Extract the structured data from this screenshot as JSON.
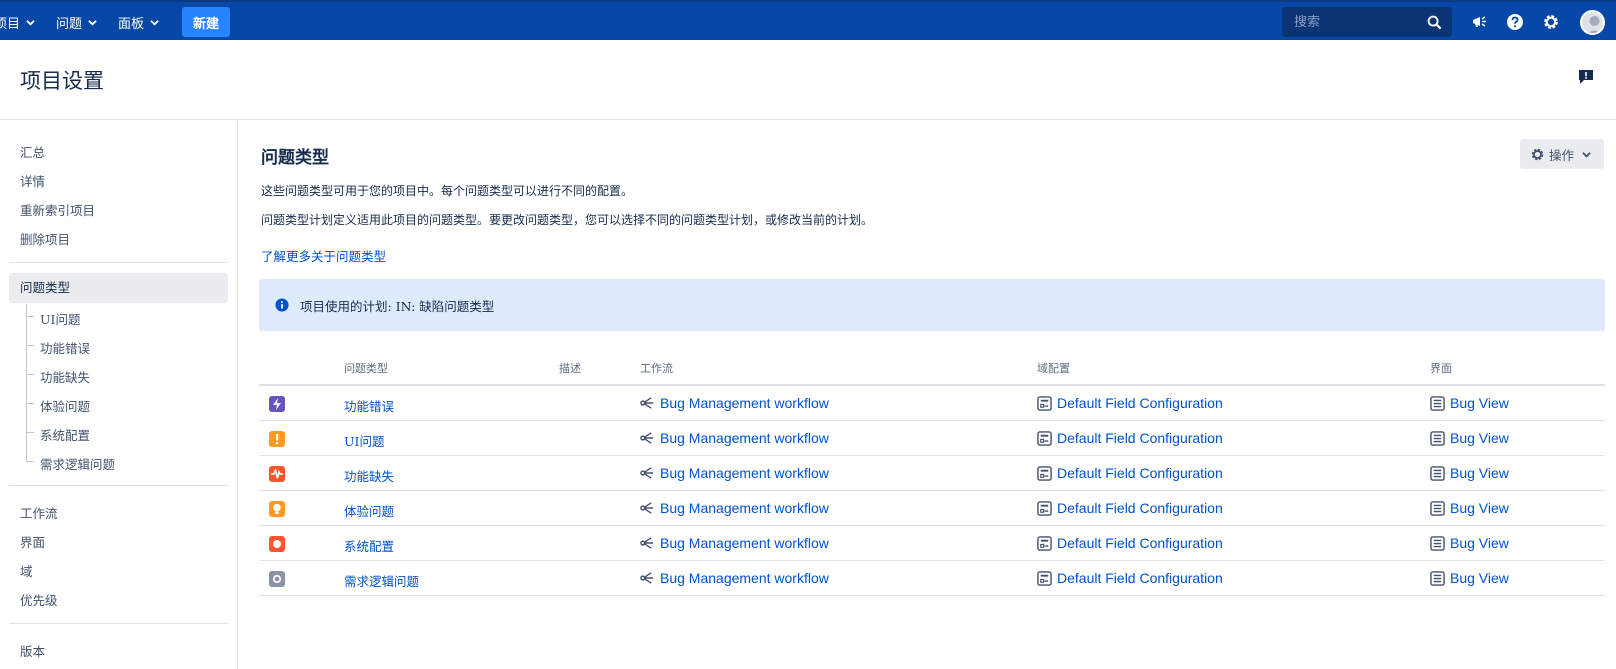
{
  "nav": {
    "menu_projects": "项目",
    "menu_issues": "问题",
    "menu_boards": "面板",
    "create_label": "新建",
    "search_placeholder": "搜索"
  },
  "header": {
    "title": "项目设置"
  },
  "sidebar": {
    "items_top": [
      "汇总",
      "详情",
      "重新索引项目",
      "删除项目"
    ],
    "active_item": "问题类型",
    "sub_items": [
      "UI问题",
      "功能错误",
      "功能缺失",
      "体验问题",
      "系统配置",
      "需求逻辑问题"
    ],
    "items_bottom": [
      "工作流",
      "界面",
      "域",
      "优先级"
    ],
    "items_last": [
      "版本"
    ]
  },
  "main": {
    "title": "问题类型",
    "actions_label": "操作",
    "desc1": "这些问题类型可用于您的项目中。每个问题类型可以进行不同的配置。",
    "desc2": "问题类型计划定义适用此项目的问题类型。要更改问题类型，您可以选择不同的问题类型计划，或修改当前的计划。",
    "learn_more": "了解更多关于问题类型",
    "scheme_label": "项目使用的计划: IN: 缺陷问题类型"
  },
  "table": {
    "headers": [
      "问题类型",
      "描述",
      "工作流",
      "域配置",
      "界面"
    ],
    "rows": [
      {
        "name": "功能错误",
        "icon": "bolt-icon",
        "color": "#6554c0",
        "workflow": "Bug Management workflow",
        "field_config": "Default Field Configuration",
        "screen": "Bug View"
      },
      {
        "name": "UI问题",
        "icon": "exclamation-icon",
        "color": "#ff991f",
        "workflow": "Bug Management workflow",
        "field_config": "Default Field Configuration",
        "screen": "Bug View"
      },
      {
        "name": "功能缺失",
        "icon": "pulse-icon",
        "color": "#ff5630",
        "workflow": "Bug Management workflow",
        "field_config": "Default Field Configuration",
        "screen": "Bug View"
      },
      {
        "name": "体验问题",
        "icon": "bulb-icon",
        "color": "#ff991f",
        "workflow": "Bug Management workflow",
        "field_config": "Default Field Configuration",
        "screen": "Bug View"
      },
      {
        "name": "系统配置",
        "icon": "circle-icon",
        "color": "#ff5630",
        "workflow": "Bug Management workflow",
        "field_config": "Default Field Configuration",
        "screen": "Bug View"
      },
      {
        "name": "需求逻辑问题",
        "icon": "ring-icon",
        "color": "#8993a4",
        "workflow": "Bug Management workflow",
        "field_config": "Default Field Configuration",
        "screen": "Bug View"
      }
    ]
  }
}
